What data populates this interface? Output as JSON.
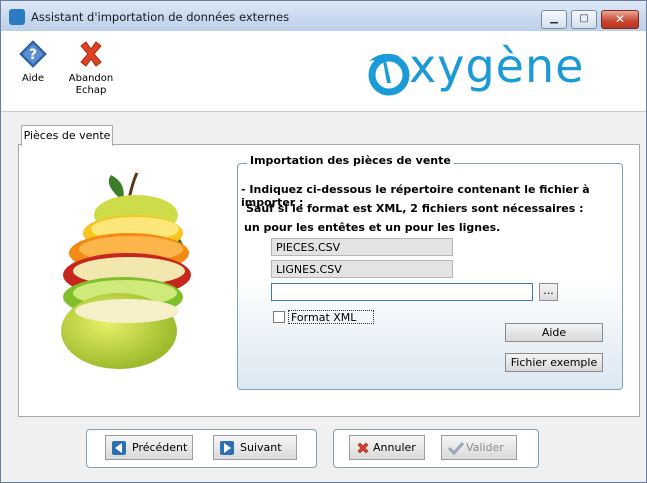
{
  "window": {
    "title": "Assistant d'importation de données externes",
    "controls": [
      "minimize",
      "maximize",
      "close"
    ]
  },
  "toolbar": {
    "help_label": "Aide",
    "cancel_label_line1": "Abandon",
    "cancel_label_line2": "Echap"
  },
  "brand": {
    "logo_text": "xygène"
  },
  "tabs": [
    {
      "label": "Pièces de vente",
      "selected": true
    }
  ],
  "import_group": {
    "title": "Importation des pièces de vente",
    "instructions": [
      "- Indiquez ci-dessous le répertoire contenant le fichier à importer :",
      "Sauf si le format est XML, 2 fichiers sont nécessaires :",
      "un pour les entêtes et un pour les lignes."
    ],
    "file_header": "PIECES.CSV",
    "file_lines": "LIGNES.CSV",
    "directory_value": "",
    "browse_label": "...",
    "xml_checkbox_label": "Format XML",
    "xml_checked": false,
    "help_button": "Aide",
    "example_button": "Fichier exemple"
  },
  "navigation": {
    "previous_label": "Précédent",
    "next_label": "Suivant",
    "cancel_label": "Annuler",
    "validate_label": "Valider",
    "validate_enabled": false
  },
  "colors": {
    "accent": "#1a9ad6",
    "close_red": "#d8412b"
  }
}
